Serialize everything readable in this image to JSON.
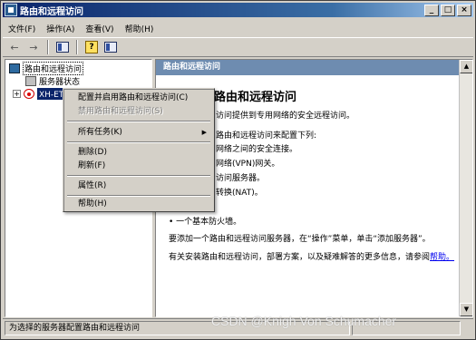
{
  "window": {
    "title": "路由和远程访问",
    "buttons": [
      "_",
      "□",
      "×"
    ]
  },
  "menubar": [
    "文件(F)",
    "操作(A)",
    "查看(V)",
    "帮助(H)"
  ],
  "toolbar": {
    "icons": [
      "back-arrow-icon",
      "forward-arrow-icon",
      "show-hide-tree-icon",
      "help-icon",
      "properties-icon"
    ]
  },
  "tree": {
    "root": "路由和远程访问",
    "items": [
      {
        "label": "服务器状态"
      },
      {
        "label": "XH-ET********* (本地)"
      }
    ]
  },
  "right_pane": {
    "header": "路由和远程访问",
    "heading": "路由和远程访问",
    "paragraphs": [
      "访问提供到专用网络的安全远程访问。",
      "路由和远程访问来配置下列:"
    ],
    "bullets": [
      "网络之间的安全连接。",
      "网络(VPN)网关。",
      "访问服务器。",
      "转换(NAT)。",
      "• LAN 路由。",
      "• 一个基本防火墙。"
    ],
    "instruction": "要添加一个路由和远程访问服务器，在“操作”菜单，单击“添加服务器”。",
    "more_info": "有关安装路由和远程访问，部署方案，以及疑难解答的更多信息，请参阅",
    "help_link": "帮助。"
  },
  "context_menu": {
    "items": [
      {
        "label": "配置并启用路由和远程访问(C)",
        "disabled": false
      },
      {
        "label": "禁用路由和远程访问(S)",
        "disabled": true
      },
      {
        "label": "所有任务(K)",
        "submenu": true
      },
      {
        "label": "删除(D)"
      },
      {
        "label": "刷新(F)"
      },
      {
        "label": "属性(R)"
      },
      {
        "label": "帮助(H)"
      }
    ]
  },
  "statusbar": {
    "text": "为选择的服务器配置路由和远程访问"
  },
  "watermark": "CSDN @Knigh Von Schumacher"
}
